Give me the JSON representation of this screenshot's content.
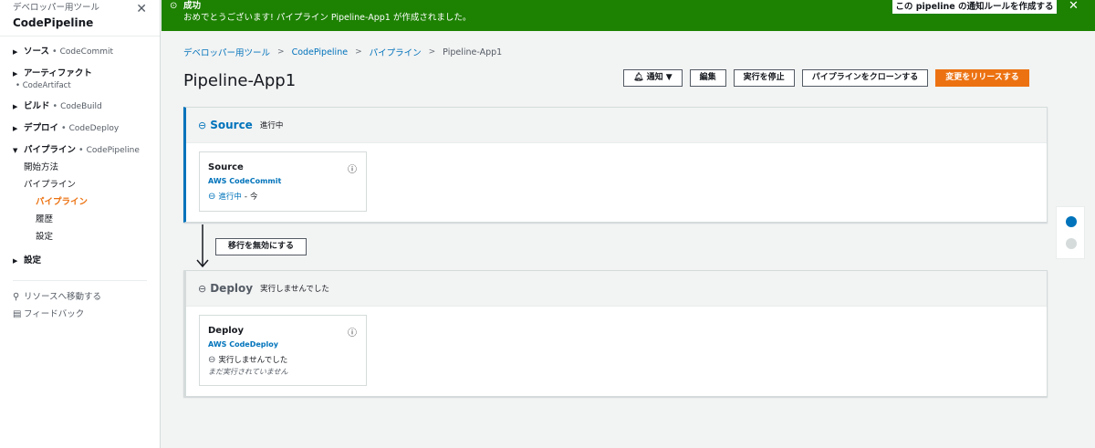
{
  "sidebar": {
    "subtitle": "デベロッパー用ツール",
    "title": "CodePipeline",
    "close_icon": "close-icon",
    "sections": [
      {
        "name": "ソース",
        "service": "CodeCommit"
      },
      {
        "name": "アーティファクト",
        "service": "CodeArtifact"
      },
      {
        "name": "ビルド",
        "service": "CodeBuild"
      },
      {
        "name": "デプロイ",
        "service": "CodeDeploy"
      },
      {
        "name": "パイプライン",
        "service": "CodePipeline"
      }
    ],
    "pipeline_items": {
      "getting_started": "開始方法",
      "pipelines_group": "パイプライン",
      "pipelines": "パイプライン",
      "history": "履歴",
      "settings": "設定"
    },
    "settings": "設定",
    "go_to_resource": "リソースへ移動する",
    "feedback": "フィードバック"
  },
  "banner": {
    "title": "成功",
    "message": "おめでとうございます! パイプライン Pipeline-App1 が作成されました。",
    "button": "この pipeline の通知ルールを作成する",
    "bg_color": "#1d8102"
  },
  "breadcrumb": {
    "items": [
      "デベロッパー用ツール",
      "CodePipeline",
      "パイプライン"
    ],
    "current": "Pipeline-App1"
  },
  "page": {
    "title": "Pipeline-App1"
  },
  "actions": {
    "notify": "通知",
    "edit": "編集",
    "stop": "実行を停止",
    "clone": "パイプラインをクローンする",
    "release": "変更をリリースする",
    "accent_color": "#ec7211"
  },
  "stages": [
    {
      "name": "Source",
      "status": "進行中",
      "action": {
        "name": "Source",
        "provider": "AWS CodeCommit",
        "status": "進行中",
        "time": "今"
      }
    },
    {
      "name": "Deploy",
      "status": "実行しませんでした",
      "action": {
        "name": "Deploy",
        "provider": "AWS CodeDeploy",
        "status": "実行しませんでした",
        "note": "まだ実行されていません"
      }
    }
  ],
  "transition": {
    "button": "移行を無効にする"
  }
}
